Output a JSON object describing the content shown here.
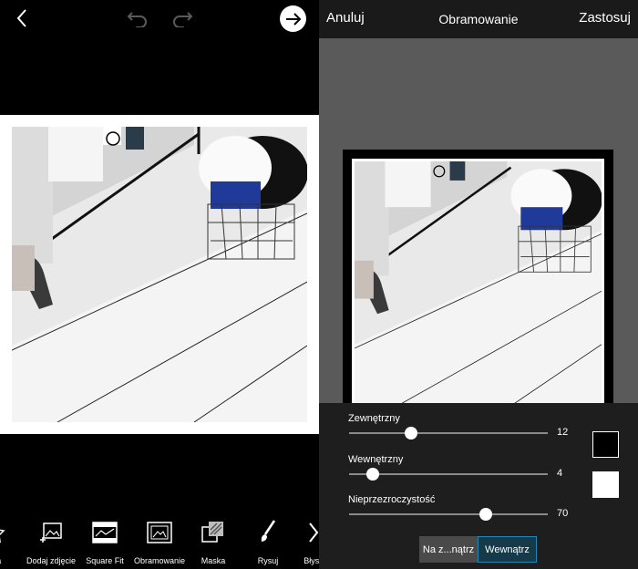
{
  "editor": {
    "tools": [
      {
        "label": "oka",
        "icon": "sticker-icon"
      },
      {
        "label": "Dodaj zdjęcie",
        "icon": "add-photo-icon"
      },
      {
        "label": "Square Fit",
        "icon": "square-fit-icon"
      },
      {
        "label": "Obramowanie",
        "icon": "border-icon"
      },
      {
        "label": "Maska",
        "icon": "mask-icon"
      },
      {
        "label": "Rysuj",
        "icon": "brush-icon"
      },
      {
        "label": "Błysk",
        "icon": "next-tools-icon"
      }
    ]
  },
  "border_panel": {
    "cancel_label": "Anuluj",
    "title": "Obramowanie",
    "apply_label": "Zastosuj",
    "sliders": [
      {
        "label": "Zewnętrzny",
        "value": "12",
        "fraction": 0.31
      },
      {
        "label": "Wewnętrzny",
        "value": "4",
        "fraction": 0.12
      },
      {
        "label": "Nieprzezroczystość",
        "value": "70",
        "fraction": 0.69
      }
    ],
    "swatches": [
      {
        "name": "outer-color",
        "color": "#000000"
      },
      {
        "name": "inner-color",
        "color": "#ffffff"
      }
    ],
    "segments": [
      {
        "label": "Na z...nątrz",
        "active": false
      },
      {
        "label": "Wewnątrz",
        "active": true
      }
    ]
  }
}
